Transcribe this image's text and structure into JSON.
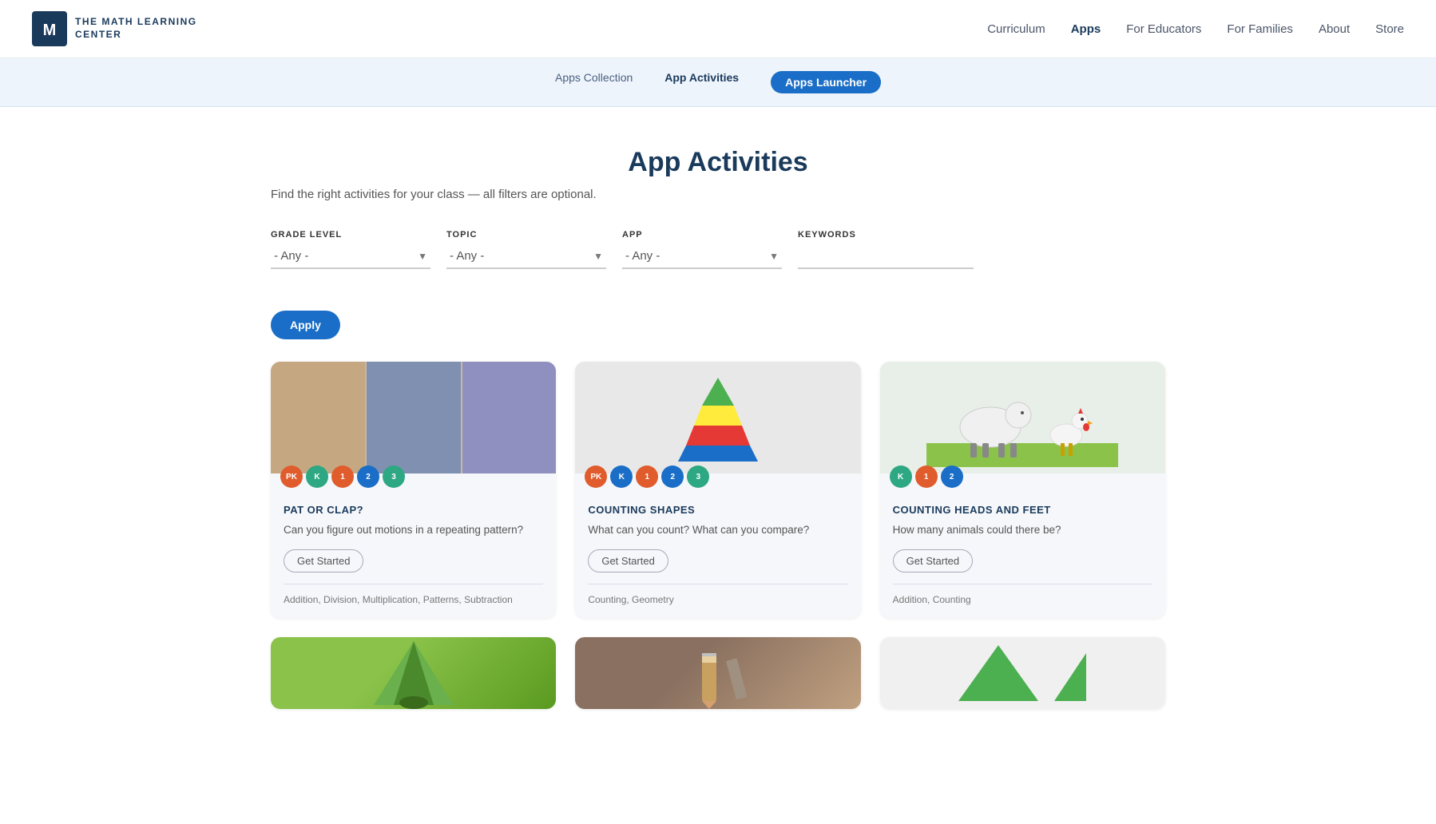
{
  "header": {
    "logo_text_line1": "The MATH LEARNING",
    "logo_text_line2": "CENTER",
    "nav": [
      {
        "label": "Curriculum",
        "active": false
      },
      {
        "label": "Apps",
        "active": true
      },
      {
        "label": "For Educators",
        "active": false
      },
      {
        "label": "For Families",
        "active": false
      },
      {
        "label": "About",
        "active": false
      },
      {
        "label": "Store",
        "active": false
      }
    ]
  },
  "sub_nav": [
    {
      "label": "Apps Collection",
      "active": false,
      "btn": false
    },
    {
      "label": "App Activities",
      "active": true,
      "btn": false
    },
    {
      "label": "Apps Launcher",
      "active": false,
      "btn": true
    }
  ],
  "page": {
    "title": "App Activities",
    "subtitle": "Find the right activities for your class — all filters are optional."
  },
  "filters": {
    "grade_level": {
      "label": "GRADE LEVEL",
      "value": "- Any -"
    },
    "topic": {
      "label": "TOPIC",
      "value": "- Any -"
    },
    "app": {
      "label": "APP",
      "value": "- Any -"
    },
    "keywords": {
      "label": "KEYWORDS",
      "placeholder": ""
    },
    "apply_label": "Apply"
  },
  "cards": [
    {
      "id": "pat-or-clap",
      "title": "PAT OR CLAP?",
      "description": "Can you figure out motions in a repeating pattern?",
      "get_started": "Get Started",
      "tags": "Addition, Division, Multiplication, Patterns, Subtraction",
      "grades": [
        {
          "label": "PK",
          "color": "badge-pk"
        },
        {
          "label": "K",
          "color": "badge-k"
        },
        {
          "label": "1",
          "color": "badge-1"
        },
        {
          "label": "2",
          "color": "badge-2"
        },
        {
          "label": "3",
          "color": "badge-3"
        }
      ],
      "type": "patclap"
    },
    {
      "id": "counting-shapes",
      "title": "COUNTING SHAPES",
      "description": "What can you count? What can you compare?",
      "get_started": "Get Started",
      "tags": "Counting, Geometry",
      "grades": [
        {
          "label": "PK",
          "color": "badge-pk"
        },
        {
          "label": "K",
          "color": "badge-k-blue"
        },
        {
          "label": "1",
          "color": "badge-1"
        },
        {
          "label": "2",
          "color": "badge-2"
        },
        {
          "label": "3",
          "color": "badge-3"
        }
      ],
      "type": "shapes"
    },
    {
      "id": "counting-heads-feet",
      "title": "COUNTING HEADS AND FEET",
      "description": "How many animals could there be?",
      "get_started": "Get Started",
      "tags": "Addition, Counting",
      "grades": [
        {
          "label": "K",
          "color": "badge-k"
        },
        {
          "label": "1",
          "color": "badge-1"
        },
        {
          "label": "2",
          "color": "badge-2"
        }
      ],
      "type": "animals"
    }
  ],
  "partial_cards": [
    {
      "type": "tent",
      "color": "#6ab04c"
    },
    {
      "type": "pencil",
      "color": "#8a7060"
    },
    {
      "type": "triangles",
      "color": "#4caf50"
    }
  ]
}
